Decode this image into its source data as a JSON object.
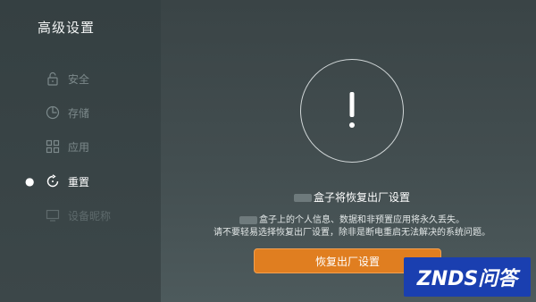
{
  "page": {
    "title": "高级设置"
  },
  "sidebar": {
    "items": [
      {
        "label": "安全",
        "icon": "lock-icon"
      },
      {
        "label": "存储",
        "icon": "pie-chart-icon"
      },
      {
        "label": "应用",
        "icon": "apps-grid-icon"
      },
      {
        "label": "重置",
        "icon": "reset-icon",
        "active": true
      },
      {
        "label": "设备昵称",
        "icon": "monitor-icon"
      }
    ]
  },
  "main": {
    "warning_symbol": "!",
    "heading": "盒子将恢复出厂设置",
    "desc_line1": "盒子上的个人信息、数据和非预置应用将永久丢失。",
    "desc_line2": "请不要轻易选择恢复出厂设置，除非是断电重启无法解决的系统问题。",
    "reset_button": "恢复出厂设置"
  },
  "watermark": {
    "text": "ZNDS问答"
  },
  "colors": {
    "accent": "#e07e20",
    "background": "#434e50"
  }
}
